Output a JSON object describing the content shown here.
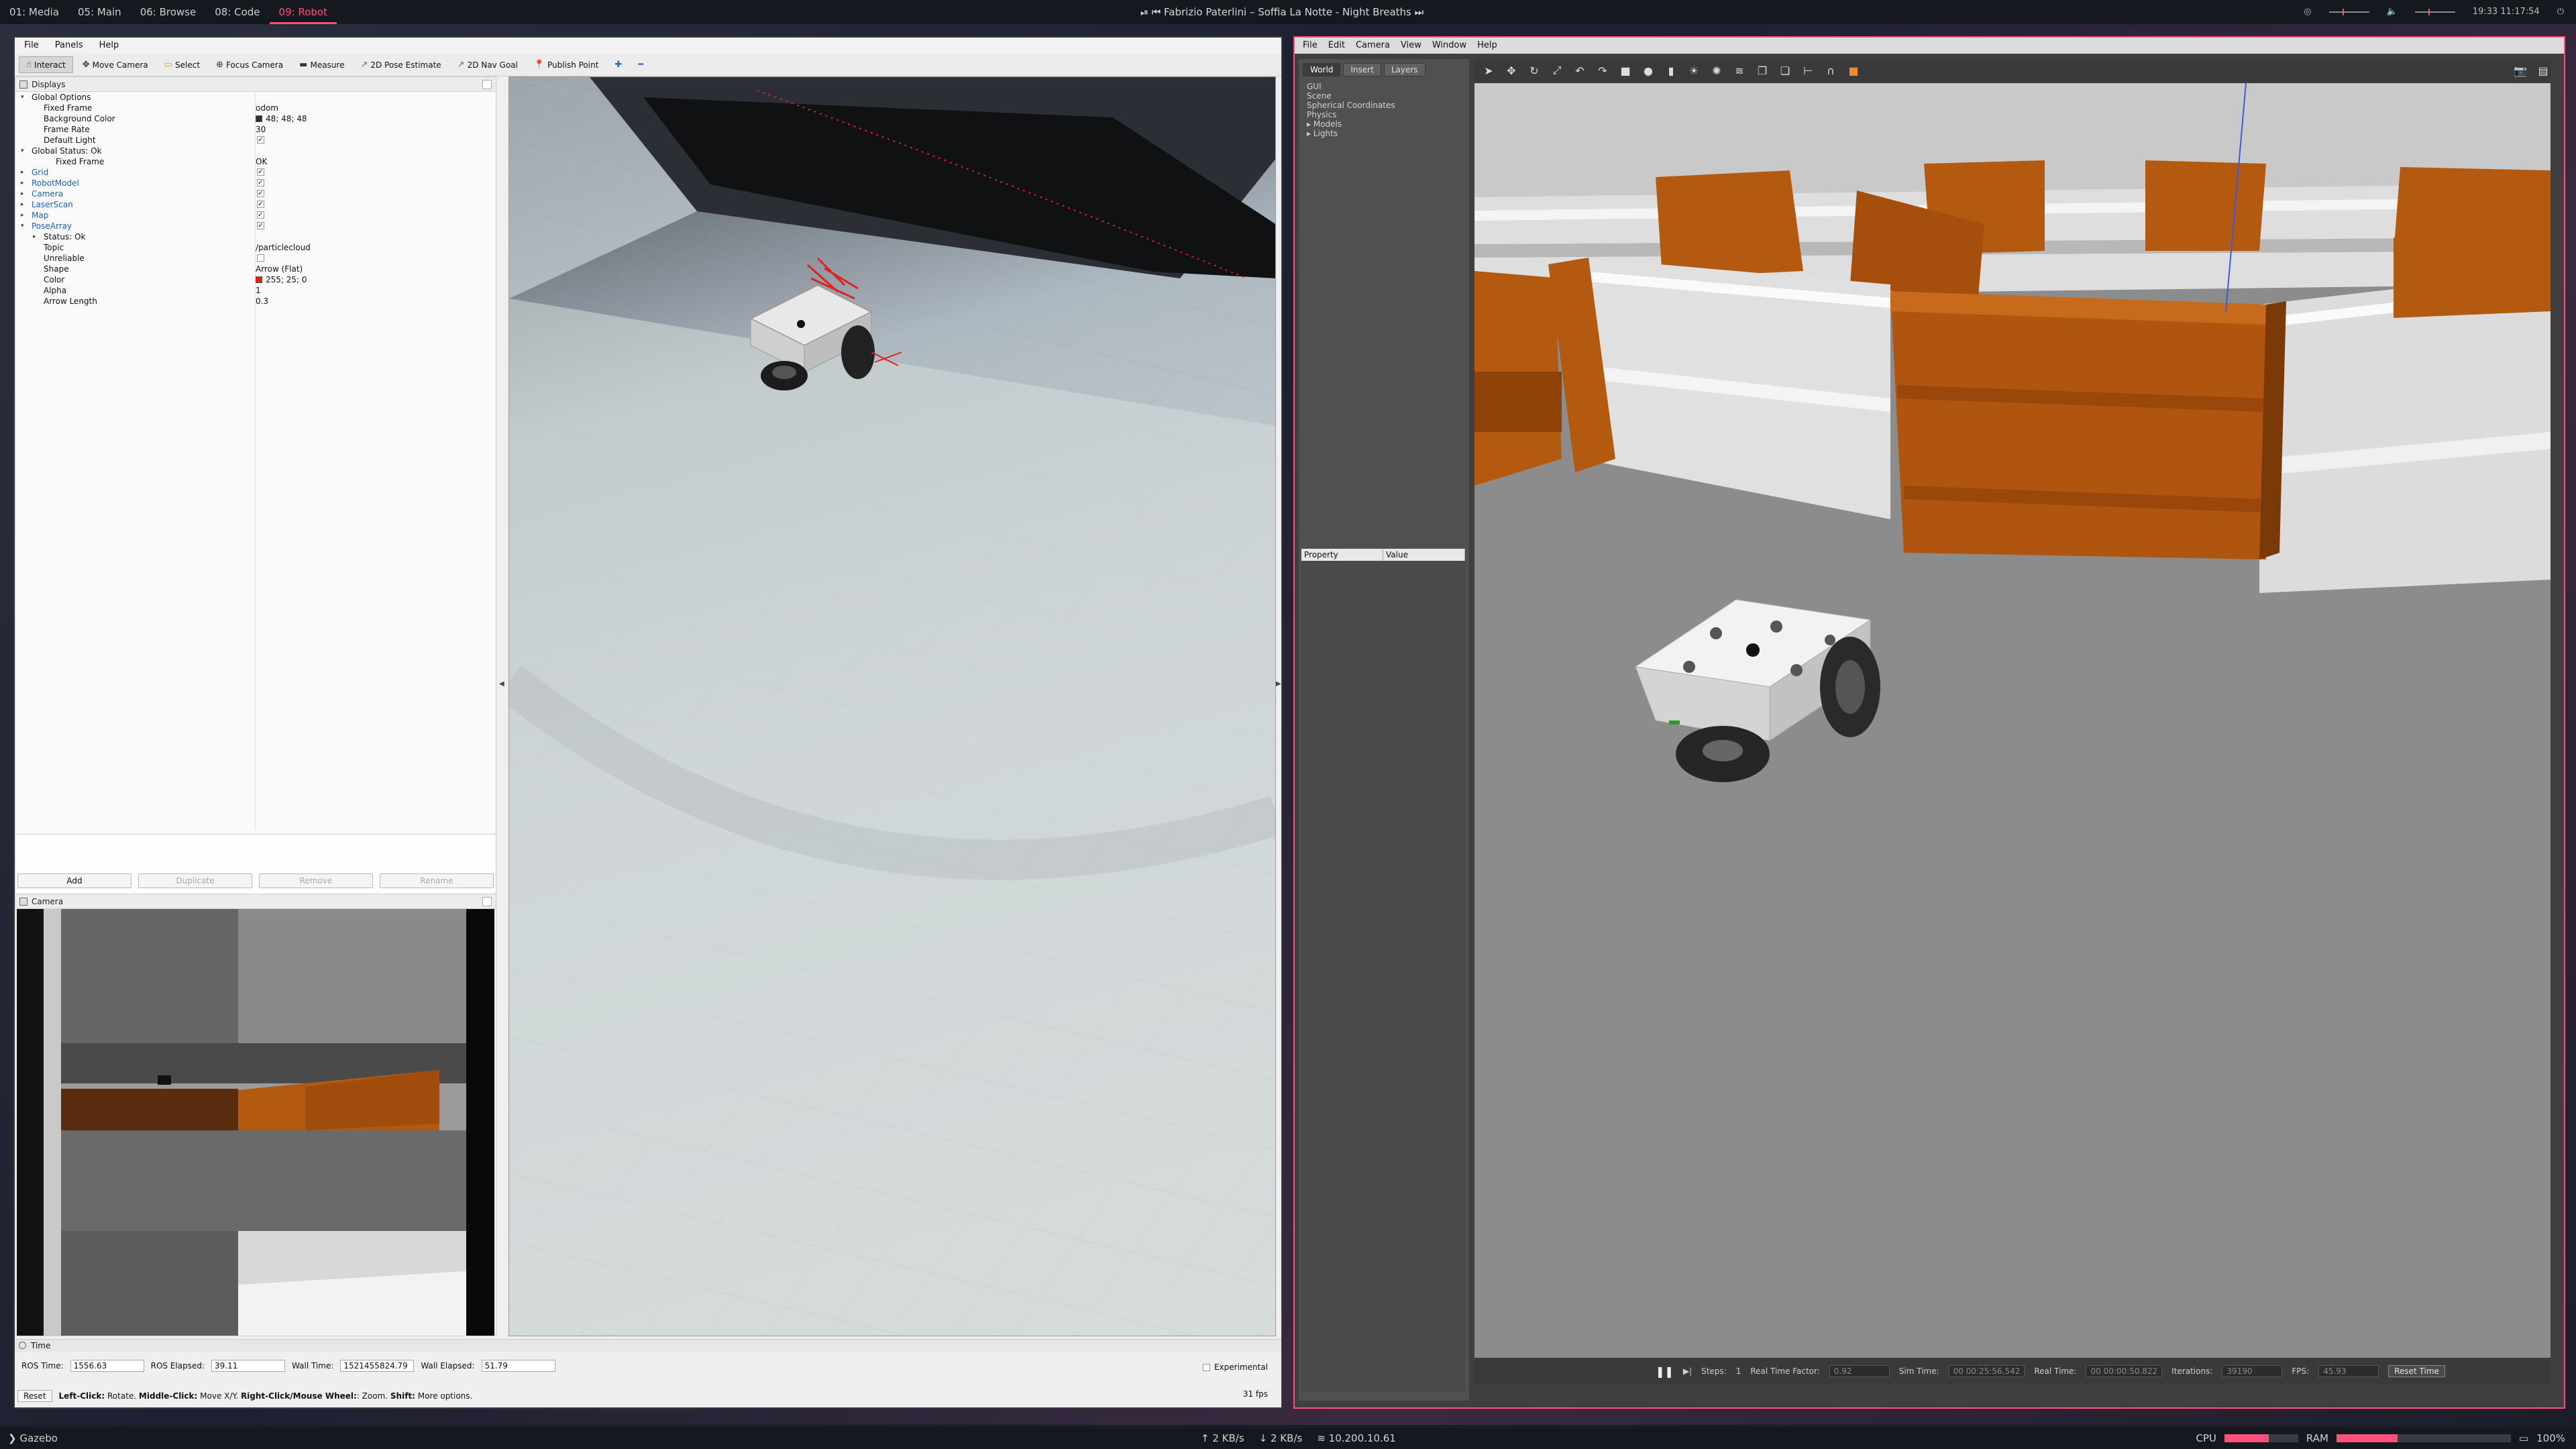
{
  "topbar": {
    "workspaces": [
      "01: Media",
      "05: Main",
      "06: Browse",
      "08: Code",
      "09: Robot"
    ],
    "active_workspace": "09: Robot",
    "media_title": "Fabrizio Paterlini – Soffia La Notte - Night Breaths",
    "clock": "19:33 11:17:54"
  },
  "rviz": {
    "menu": [
      "File",
      "Panels",
      "Help"
    ],
    "toolbar": [
      "Interact",
      "Move Camera",
      "Select",
      "Focus Camera",
      "Measure",
      "2D Pose Estimate",
      "2D Nav Goal",
      "Publish Point"
    ],
    "displays_title": "Displays",
    "tree": [
      {
        "k": "Global Options",
        "indent": 1,
        "blue": false,
        "caret": "▾"
      },
      {
        "k": "Fixed Frame",
        "v": "odom",
        "indent": 2
      },
      {
        "k": "Background Color",
        "v": "48; 48; 48",
        "indent": 2,
        "swatch": "#303030"
      },
      {
        "k": "Frame Rate",
        "v": "30",
        "indent": 2
      },
      {
        "k": "Default Light",
        "v": "",
        "indent": 2,
        "check": true
      },
      {
        "k": "Global Status: Ok",
        "indent": 1,
        "caret": "▾"
      },
      {
        "k": "Fixed Frame",
        "v": "OK",
        "indent": 3
      },
      {
        "k": "Grid",
        "indent": 1,
        "blue": true,
        "caret": "▸",
        "check": true
      },
      {
        "k": "RobotModel",
        "indent": 1,
        "blue": true,
        "caret": "▸",
        "check": true
      },
      {
        "k": "Camera",
        "indent": 1,
        "blue": true,
        "caret": "▸",
        "check": true
      },
      {
        "k": "LaserScan",
        "indent": 1,
        "blue": true,
        "caret": "▸",
        "check": true
      },
      {
        "k": "Map",
        "indent": 1,
        "blue": true,
        "caret": "▸",
        "check": true
      },
      {
        "k": "PoseArray",
        "indent": 1,
        "blue": true,
        "caret": "▾",
        "check": true
      },
      {
        "k": "Status: Ok",
        "indent": 2,
        "caret": "▸"
      },
      {
        "k": "Topic",
        "v": "/particlecloud",
        "indent": 2
      },
      {
        "k": "Unreliable",
        "v": "",
        "indent": 2,
        "check": false
      },
      {
        "k": "Shape",
        "v": "Arrow (Flat)",
        "indent": 2
      },
      {
        "k": "Color",
        "v": "255; 25; 0",
        "indent": 2,
        "swatch": "#ff1900"
      },
      {
        "k": "Alpha",
        "v": "1",
        "indent": 2
      },
      {
        "k": "Arrow Length",
        "v": "0.3",
        "indent": 2
      }
    ],
    "buttons": [
      "Add",
      "Duplicate",
      "Remove",
      "Rename"
    ],
    "camera_title": "Camera",
    "time": {
      "title": "Time",
      "ros_time_label": "ROS Time:",
      "ros_time": "1556.63",
      "ros_elapsed_label": "ROS Elapsed:",
      "ros_elapsed": "39.11",
      "wall_time_label": "Wall Time:",
      "wall_time": "1521455824.79",
      "wall_elapsed_label": "Wall Elapsed:",
      "wall_elapsed": "51.79",
      "experimental": "Experimental"
    },
    "status": {
      "reset": "Reset",
      "hint_b1": "Left-Click:",
      "hint_t1": " Rotate. ",
      "hint_b2": "Middle-Click:",
      "hint_t2": " Move X/Y. ",
      "hint_b3": "Right-Click/Mouse Wheel:",
      "hint_t3": ": Zoom. ",
      "hint_b4": "Shift:",
      "hint_t4": " More options.",
      "fps": "31 fps"
    }
  },
  "gazebo": {
    "menu": [
      "File",
      "Edit",
      "Camera",
      "View",
      "Window",
      "Help"
    ],
    "tabs": [
      "World",
      "Insert",
      "Layers"
    ],
    "tree": [
      "GUI",
      "Scene",
      "Spherical Coordinates",
      "Physics",
      "Models",
      "Lights"
    ],
    "prop_headers": [
      "Property",
      "Value"
    ],
    "bottom": {
      "steps_label": "Steps:",
      "steps": "1",
      "rtf_label": "Real Time Factor:",
      "rtf": "0.92",
      "sim_label": "Sim Time:",
      "sim": "00 00:25:56.542",
      "real_label": "Real Time:",
      "real": "00 00:00:50.822",
      "iter_label": "Iterations:",
      "iter": "39190",
      "fps_label": "FPS:",
      "fps": "45.93",
      "reset": "Reset Time"
    }
  },
  "bottombar": {
    "app": "Gazebo",
    "up": "2 KB/s",
    "down": "2 KB/s",
    "ip": "10.200.10.61",
    "cpu_label": "CPU",
    "ram_label": "RAM",
    "battery": "100%"
  },
  "colors": {
    "accent": "#ff4f7b",
    "barrier": "#b45a10"
  }
}
